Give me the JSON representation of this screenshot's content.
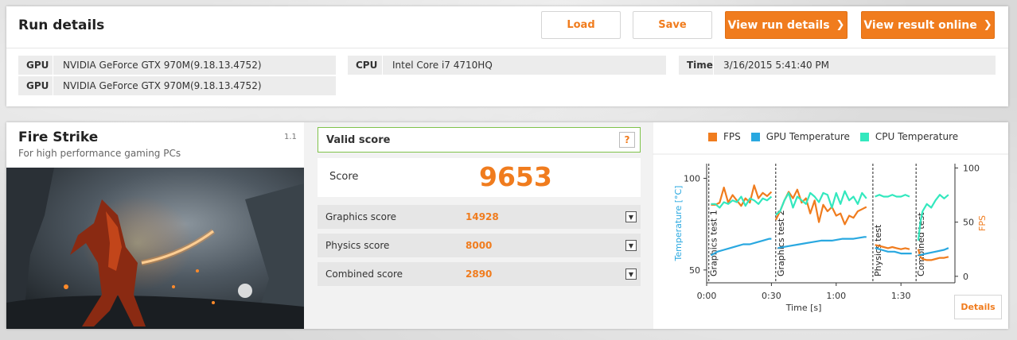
{
  "run": {
    "title": "Run details",
    "buttons": {
      "load": "Load",
      "save": "Save",
      "view_run_details": "View run details",
      "view_result_online": "View result online"
    },
    "info": [
      {
        "key": "GPU",
        "value": "NVIDIA GeForce GTX 970M(9.18.13.4752)"
      },
      {
        "key": "GPU",
        "value": "NVIDIA GeForce GTX 970M(9.18.13.4752)"
      },
      {
        "key": "CPU",
        "value": "Intel Core i7 4710HQ"
      },
      {
        "key": "Time",
        "value": "3/16/2015 5:41:40 PM"
      }
    ]
  },
  "benchmark": {
    "name": "Fire Strike",
    "subtitle": "For high performance gaming PCs",
    "version": "1.1",
    "valid_label": "Valid score",
    "help": "?",
    "score_label": "Score",
    "score": "9653",
    "subscores": [
      {
        "label": "Graphics score",
        "value": "14928"
      },
      {
        "label": "Physics score",
        "value": "8000"
      },
      {
        "label": "Combined score",
        "value": "2890"
      }
    ],
    "details_label": "Details"
  },
  "colors": {
    "accent": "#f07c1e",
    "fps": "#f07c1e",
    "gpu_temp": "#29a8e0",
    "cpu_temp": "#33e8be",
    "valid": "#7fc24a"
  },
  "icons": {
    "chevron": "chevron-right-icon",
    "help": "help-icon",
    "dropdown": "chevron-down-icon"
  },
  "chart_data": {
    "type": "line",
    "legend": [
      "FPS",
      "GPU Temperature",
      "CPU Temperature"
    ],
    "xlabel": "Time [s]",
    "ylabel": "Temperature [°C]",
    "y2label": "FPS",
    "x_ticks": [
      "0:00",
      "0:30",
      "1:00",
      "1:30"
    ],
    "y_ticks": [
      "100",
      "50"
    ],
    "y2_ticks": [
      "100",
      "50",
      "0"
    ],
    "xlim": [
      0,
      115
    ],
    "ylim": [
      43,
      108
    ],
    "y2lim": [
      -6,
      104
    ],
    "sections": [
      {
        "label": "Graphics test 1",
        "start": 1
      },
      {
        "label": "Graphics test 2",
        "start": 32
      },
      {
        "label": "Physics test",
        "start": 77
      },
      {
        "label": "Combined test",
        "start": 97
      }
    ],
    "series": [
      {
        "name": "FPS",
        "axis": "right",
        "segments": [
          {
            "x": [
              2,
              4,
              6,
              8,
              10,
              12,
              14,
              16,
              18,
              20,
              22,
              24,
              26,
              28,
              30
            ],
            "y": [
              66,
              66,
              68,
              82,
              68,
              75,
              70,
              65,
              72,
              68,
              84,
              72,
              77,
              74,
              78
            ]
          },
          {
            "x": [
              32,
              34,
              36,
              38,
              40,
              42,
              44,
              46,
              48,
              50,
              52,
              54,
              56,
              58,
              60,
              62,
              64,
              66,
              68,
              70,
              72,
              74
            ],
            "y": [
              52,
              60,
              70,
              78,
              72,
              80,
              68,
              72,
              58,
              70,
              50,
              66,
              60,
              64,
              56,
              58,
              48,
              56,
              54,
              60,
              62,
              64
            ]
          },
          {
            "x": [
              78,
              80,
              82,
              84,
              86,
              88,
              90,
              92,
              94
            ],
            "y": [
              29,
              28,
              27,
              26,
              27,
              26,
              25,
              26,
              25
            ]
          },
          {
            "x": [
              98,
              99,
              100,
              102,
              104,
              106,
              108,
              110,
              112
            ],
            "y": [
              25,
              18,
              16,
              15,
              15,
              16,
              17,
              17,
              18
            ]
          }
        ]
      },
      {
        "name": "GPU Temperature",
        "axis": "left",
        "segments": [
          {
            "x": [
              2,
              5,
              8,
              11,
              14,
              17,
              20,
              23,
              26,
              29,
              30
            ],
            "y": [
              58,
              60,
              61,
              62,
              63,
              64,
              64,
              65,
              66,
              67,
              67
            ]
          },
          {
            "x": [
              33,
              38,
              43,
              48,
              53,
              58,
              63,
              68,
              73,
              74
            ],
            "y": [
              62,
              63,
              64,
              65,
              66,
              66,
              67,
              67,
              68,
              68
            ]
          },
          {
            "x": [
              78,
              81,
              84,
              87,
              90,
              93,
              95
            ],
            "y": [
              62,
              61,
              60,
              60,
              59,
              59,
              59
            ]
          },
          {
            "x": [
              98,
              102,
              106,
              110,
              112
            ],
            "y": [
              58,
              59,
              60,
              61,
              62
            ]
          }
        ]
      },
      {
        "name": "CPU Temperature",
        "axis": "left",
        "segments": [
          {
            "x": [
              2,
              4,
              6,
              8,
              10,
              12,
              14,
              16,
              18,
              20,
              22,
              24,
              26,
              28,
              30
            ],
            "y": [
              86,
              86,
              84,
              87,
              86,
              88,
              87,
              90,
              85,
              89,
              88,
              86,
              89,
              88,
              90
            ]
          },
          {
            "x": [
              32,
              34,
              36,
              38,
              40,
              42,
              44,
              46,
              48,
              50,
              52,
              54,
              56,
              58,
              60,
              62,
              64,
              66,
              68,
              70,
              72,
              74
            ],
            "y": [
              80,
              82,
              88,
              92,
              84,
              90,
              88,
              86,
              92,
              90,
              87,
              92,
              91,
              84,
              92,
              86,
              93,
              88,
              90,
              86,
              92,
              89
            ]
          },
          {
            "x": [
              78,
              80,
              82,
              84,
              86,
              88,
              90,
              92,
              94
            ],
            "y": [
              90,
              91,
              90,
              90,
              91,
              90,
              90,
              91,
              90
            ]
          },
          {
            "x": [
              98,
              99,
              100,
              102,
              104,
              106,
              108,
              110,
              112
            ],
            "y": [
              66,
              76,
              82,
              86,
              84,
              88,
              91,
              89,
              91
            ]
          }
        ]
      }
    ]
  }
}
